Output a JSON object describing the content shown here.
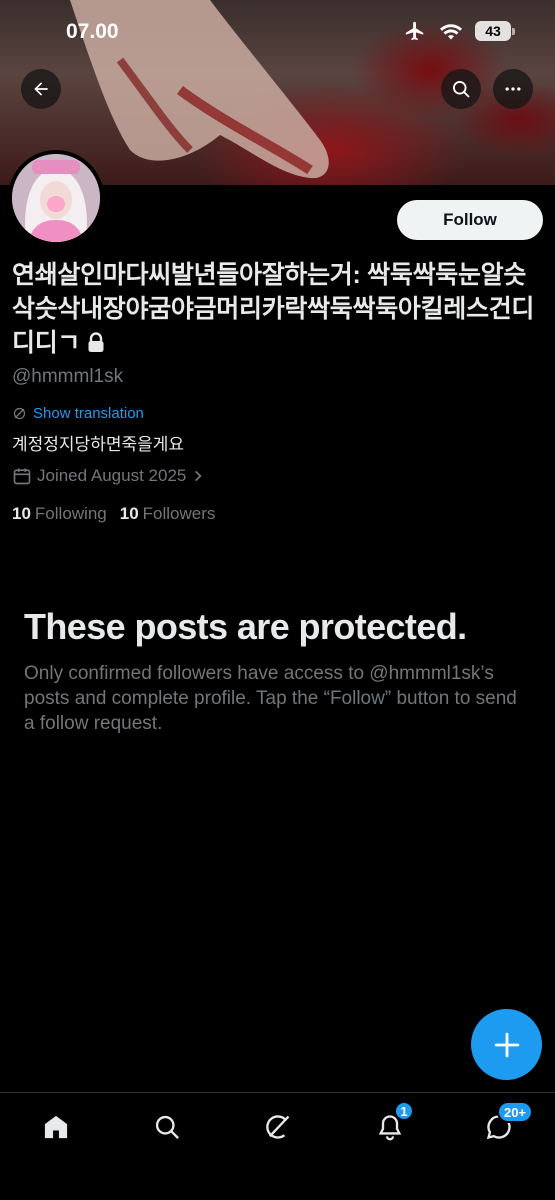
{
  "status_bar": {
    "time": "07.00",
    "battery": "43"
  },
  "profile": {
    "display_name": "연쇄살인마다씨발년들아잘하는거: 싹둑싹둑눈알슷삭슷삭내장야굼야금머리카락싹둑싹둑아킬레스건디디디ㄱ",
    "handle": "@hmmml1sk",
    "follow_label": "Follow",
    "show_translation": "Show translation",
    "bio": "계정정지당하면죽을게요",
    "joined": "Joined August 2025",
    "following_count": "10",
    "following_label": "Following",
    "followers_count": "10",
    "followers_label": "Followers"
  },
  "protected": {
    "title": "These posts are protected.",
    "description": "Only confirmed followers have access to @hmmml1sk’s posts and complete profile. Tap the “Follow” button to send a follow request."
  },
  "bottom_nav": {
    "items": [
      {
        "icon": "home-icon"
      },
      {
        "icon": "search-icon"
      },
      {
        "icon": "grok-icon"
      },
      {
        "icon": "bell-icon",
        "badge": "1"
      },
      {
        "icon": "messages-icon",
        "badge": "20+"
      }
    ]
  },
  "colors": {
    "accent": "#1d9bf0",
    "background": "#000000",
    "muted": "#71767b",
    "text": "#e7e9ea"
  }
}
